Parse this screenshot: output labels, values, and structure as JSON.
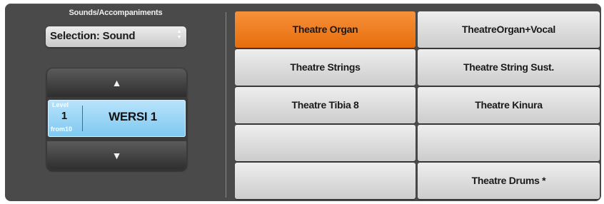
{
  "panel": {
    "title": "Sounds/Accompaniments",
    "select_label": "Selection: Sound",
    "select_arrows": [
      "▲",
      "▼"
    ]
  },
  "selector": {
    "up_glyph": "▲",
    "down_glyph": "▼",
    "level_label": "Level",
    "level_value": "1",
    "level_from": "from10",
    "name": "WERSI 1",
    "panel_color": "#8fd0f5"
  },
  "sounds": {
    "buttons": [
      {
        "label": "Theatre Organ",
        "active": true
      },
      {
        "label": "TheatreOrgan+Vocal",
        "active": false
      },
      {
        "label": "Theatre Strings",
        "active": false
      },
      {
        "label": "Theatre String Sust.",
        "active": false
      },
      {
        "label": "Theatre Tibia 8",
        "active": false
      },
      {
        "label": "Theatre Kinura",
        "active": false
      },
      {
        "label": "",
        "active": false
      },
      {
        "label": "",
        "active": false
      },
      {
        "label": "",
        "active": false
      },
      {
        "label": "Theatre Drums *",
        "active": false
      }
    ],
    "active_color": "#f07f1f",
    "button_color": "#dcdcdc"
  }
}
